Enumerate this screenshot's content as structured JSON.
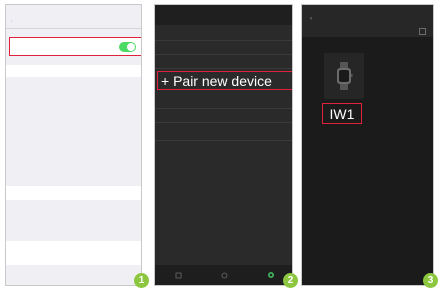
{
  "panel2": {
    "pair_device_label": "+ Pair new device"
  },
  "panel3": {
    "device_name": "IW1"
  },
  "badges": [
    "1",
    "2",
    "3"
  ],
  "colors": {
    "highlight": "#e0213b",
    "toggle_on": "#4cd964",
    "badge": "#8dc63f",
    "active_tab": "#3fae5a"
  },
  "icons": [
    "chevron-left-icon",
    "bluetooth-toggle",
    "watch-icon",
    "settings-tab-icon",
    "scan-icon"
  ]
}
